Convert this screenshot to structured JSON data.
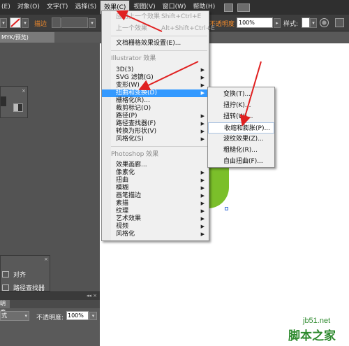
{
  "menubar": {
    "items": [
      {
        "label": "(E)"
      },
      {
        "label": "对象(O)"
      },
      {
        "label": "文字(T)"
      },
      {
        "label": "选择(S)"
      },
      {
        "label": "效果(C)"
      },
      {
        "label": "视图(V)"
      },
      {
        "label": "窗口(W)"
      },
      {
        "label": "帮助(H)"
      }
    ]
  },
  "control_bar": {
    "stroke_label": "描边",
    "opacity_label": "不透明度",
    "opacity_value": "100%",
    "style_label": "样式:"
  },
  "document_tab": {
    "label": "MYK/预览)"
  },
  "effect_menu": {
    "items": [
      {
        "label": "应用上一个效果",
        "shortcut": "Shift+Ctrl+E",
        "type": "disabled"
      },
      {
        "label": "上一个效果",
        "shortcut": "Alt+Shift+Ctrl+E",
        "type": "disabled"
      },
      {
        "label": "文档栅格效果设置(E)...",
        "type": "normal"
      },
      {
        "label": "Illustrator 效果",
        "type": "header"
      },
      {
        "label": "3D(3)",
        "type": "submenu"
      },
      {
        "label": "SVG 滤镜(G)",
        "type": "submenu"
      },
      {
        "label": "变形(W)",
        "type": "submenu"
      },
      {
        "label": "扭曲和变换(D)",
        "type": "highlighted"
      },
      {
        "label": "栅格化(R)...",
        "type": "normal"
      },
      {
        "label": "裁剪标记(O)",
        "type": "normal"
      },
      {
        "label": "路径(P)",
        "type": "submenu"
      },
      {
        "label": "路径查找器(F)",
        "type": "submenu"
      },
      {
        "label": "转换为形状(V)",
        "type": "submenu"
      },
      {
        "label": "风格化(S)",
        "type": "submenu"
      },
      {
        "label": "Photoshop 效果",
        "type": "header"
      },
      {
        "label": "效果画廊...",
        "type": "normal"
      },
      {
        "label": "像素化",
        "type": "submenu"
      },
      {
        "label": "扭曲",
        "type": "submenu"
      },
      {
        "label": "模糊",
        "type": "submenu"
      },
      {
        "label": "画笔描边",
        "type": "submenu"
      },
      {
        "label": "素描",
        "type": "submenu"
      },
      {
        "label": "纹理",
        "type": "submenu"
      },
      {
        "label": "艺术效果",
        "type": "submenu"
      },
      {
        "label": "视频",
        "type": "submenu"
      },
      {
        "label": "风格化",
        "type": "submenu"
      }
    ]
  },
  "distort_submenu": {
    "items": [
      {
        "label": "变换(T)..."
      },
      {
        "label": "扭拧(K)..."
      },
      {
        "label": "扭转(W)..."
      },
      {
        "label": "收缩和膨胀(P)..."
      },
      {
        "label": "波纹效果(Z)..."
      },
      {
        "label": "粗糙化(R)..."
      },
      {
        "label": "自由扭曲(F)..."
      }
    ]
  },
  "panels": {
    "align_label": "对齐",
    "pathfinder_label": "路径查找器",
    "transparency_tab": "明度",
    "blend_mode": "式",
    "opacity_label": "不透明度:",
    "opacity_value": "100%"
  },
  "watermark": {
    "url": "jb51.net",
    "name": "脚本之家"
  },
  "colors": {
    "highlight": "#3399ff",
    "annotation_arrow": "#e02020",
    "shape_fill": "#7bbf2a"
  }
}
